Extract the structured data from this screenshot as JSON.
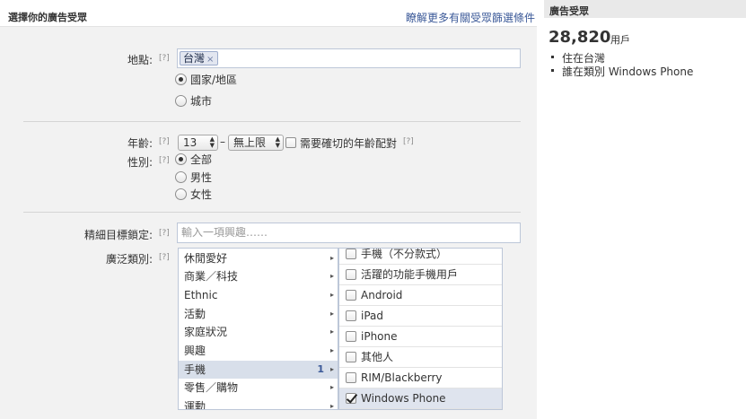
{
  "header": {
    "title": "選擇你的廣告受眾",
    "learn_more_link": "瞭解更多有關受眾篩選條件"
  },
  "location": {
    "label": "地點:",
    "help": "[?]",
    "token": "台灣",
    "token_remove": "×",
    "options": [
      {
        "label": "國家/地區",
        "selected": true
      },
      {
        "label": "城市",
        "selected": false
      }
    ]
  },
  "age": {
    "label": "年齡:",
    "help": "[?]",
    "min": "13",
    "separator": "–",
    "max": "無上限",
    "exact_match_label": "需要確切的年齡配對",
    "exact_match_checked": false,
    "exact_match_help": "[?]"
  },
  "gender": {
    "label": "性別:",
    "help": "[?]",
    "options": [
      {
        "label": "全部",
        "selected": true
      },
      {
        "label": "男性",
        "selected": false
      },
      {
        "label": "女性",
        "selected": false
      }
    ]
  },
  "precise_interests": {
    "label": "精細目標鎖定:",
    "help": "[?]",
    "placeholder": "輸入一項興趣……"
  },
  "broad_categories": {
    "label": "廣泛類別:",
    "help": "[?]",
    "categories": [
      {
        "label": "休閒愛好",
        "count": "",
        "selected": false
      },
      {
        "label": "商業／科技",
        "count": "",
        "selected": false
      },
      {
        "label": "Ethnic",
        "count": "",
        "selected": false
      },
      {
        "label": "活動",
        "count": "",
        "selected": false
      },
      {
        "label": "家庭狀況",
        "count": "",
        "selected": false
      },
      {
        "label": "興趣",
        "count": "",
        "selected": false
      },
      {
        "label": "手機",
        "count": "1",
        "selected": true
      },
      {
        "label": "零售／購物",
        "count": "",
        "selected": false
      },
      {
        "label": "運動",
        "count": "",
        "selected": false
      }
    ],
    "arrow": "▸",
    "subcategories": [
      {
        "label": "手機（不分款式）",
        "checked": false
      },
      {
        "label": "活躍的功能手機用戶",
        "checked": false
      },
      {
        "label": "Android",
        "checked": false
      },
      {
        "label": "iPad",
        "checked": false
      },
      {
        "label": "iPhone",
        "checked": false
      },
      {
        "label": "其他人",
        "checked": false
      },
      {
        "label": "RIM/Blackberry",
        "checked": false
      },
      {
        "label": "Windows Phone",
        "checked": true
      }
    ]
  },
  "audience": {
    "title": "廣告受眾",
    "reach": "28,820",
    "unit": "用戶",
    "criteria": [
      "住在台灣",
      "誰在類別 Windows Phone"
    ]
  }
}
